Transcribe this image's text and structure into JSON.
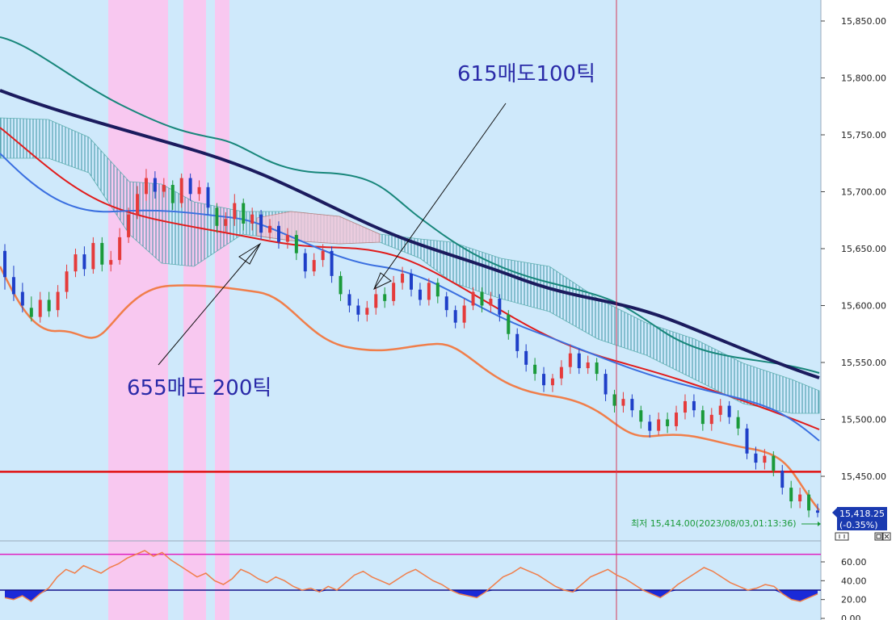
{
  "colors": {
    "plot_bg": "#cfe9fb",
    "highlight": "#f8c8f0",
    "axis_bg": "#ffffff",
    "up": "#e53b3b",
    "down": "#1f3fc8",
    "green_candle": "#1a9a3a",
    "ma_navy": "#1b1b5e",
    "ma_teal": "#17867a",
    "ma_red": "#e11b1b",
    "ma_blue": "#3a6fe0",
    "ma_orange": "#f07e4a",
    "level_line": "#e01010",
    "cursor_line": "#d43a5a",
    "osc_line": "#f07e4a",
    "osc_fill": "#1a2ad8",
    "osc_upper": "#e020c0",
    "osc_lower": "#10108a",
    "annotation": "#2a2aa8",
    "price_tag": "#1a3ab0"
  },
  "annotations": {
    "sell_615": "615매도100틱",
    "sell_655": "655매도 200틱"
  },
  "low_marker": "최저 15,414.00(2023/08/03,01:13:36)",
  "current_price": {
    "value": "15,418.25",
    "change": "(-0.35%)"
  },
  "panel_icons": [
    "collapse-icon",
    "close-icon"
  ],
  "chart_data": {
    "type": "candlestick",
    "y_ticks": [
      "15,850.00",
      "15,800.00",
      "15,750.00",
      "15,700.00",
      "15,650.00",
      "15,600.00",
      "15,550.00",
      "15,500.00",
      "15,450.00"
    ],
    "ylim": [
      15415,
      15865
    ],
    "horizontal_level": 15454,
    "candles": [
      [
        15648,
        15625,
        15654,
        15614,
        "down"
      ],
      [
        15625,
        15610,
        15635,
        15604,
        "down"
      ],
      [
        15612,
        15600,
        15620,
        15594,
        "down"
      ],
      [
        15598,
        15590,
        15608,
        15586,
        "green"
      ],
      [
        15590,
        15605,
        15612,
        15585,
        "up"
      ],
      [
        15605,
        15595,
        15612,
        15590,
        "green"
      ],
      [
        15596,
        15612,
        15618,
        15590,
        "up"
      ],
      [
        15612,
        15630,
        15636,
        15606,
        "up"
      ],
      [
        15630,
        15645,
        15650,
        15625,
        "up"
      ],
      [
        15645,
        15632,
        15652,
        15626,
        "down"
      ],
      [
        15632,
        15655,
        15660,
        15628,
        "up"
      ],
      [
        15655,
        15636,
        15660,
        15630,
        "green"
      ],
      [
        15636,
        15640,
        15648,
        15630,
        "up"
      ],
      [
        15640,
        15660,
        15668,
        15636,
        "up"
      ],
      [
        15660,
        15680,
        15686,
        15655,
        "up"
      ],
      [
        15680,
        15698,
        15705,
        15676,
        "up"
      ],
      [
        15698,
        15712,
        15720,
        15692,
        "up"
      ],
      [
        15712,
        15700,
        15718,
        15694,
        "down"
      ],
      [
        15700,
        15706,
        15712,
        15695,
        "up"
      ],
      [
        15706,
        15690,
        15710,
        15684,
        "green"
      ],
      [
        15690,
        15712,
        15716,
        15686,
        "up"
      ],
      [
        15712,
        15698,
        15716,
        15692,
        "down"
      ],
      [
        15698,
        15704,
        15710,
        15692,
        "up"
      ],
      [
        15704,
        15686,
        15708,
        15680,
        "down"
      ],
      [
        15686,
        15670,
        15690,
        15664,
        "green"
      ],
      [
        15670,
        15676,
        15682,
        15664,
        "up"
      ],
      [
        15676,
        15690,
        15698,
        15670,
        "up"
      ],
      [
        15690,
        15672,
        15694,
        15666,
        "green"
      ],
      [
        15672,
        15680,
        15686,
        15666,
        "up"
      ],
      [
        15680,
        15664,
        15684,
        15658,
        "down"
      ],
      [
        15664,
        15670,
        15676,
        15658,
        "up"
      ],
      [
        15670,
        15656,
        15674,
        15650,
        "down"
      ],
      [
        15656,
        15662,
        15668,
        15650,
        "up"
      ],
      [
        15662,
        15646,
        15666,
        15640,
        "green"
      ],
      [
        15646,
        15630,
        15650,
        15624,
        "down"
      ],
      [
        15630,
        15640,
        15646,
        15626,
        "up"
      ],
      [
        15640,
        15648,
        15654,
        15634,
        "up"
      ],
      [
        15648,
        15626,
        15652,
        15620,
        "down"
      ],
      [
        15626,
        15610,
        15630,
        15604,
        "green"
      ],
      [
        15610,
        15600,
        15614,
        15594,
        "down"
      ],
      [
        15600,
        15592,
        15606,
        15586,
        "down"
      ],
      [
        15592,
        15598,
        15604,
        15586,
        "up"
      ],
      [
        15598,
        15610,
        15616,
        15592,
        "up"
      ],
      [
        15610,
        15604,
        15616,
        15598,
        "green"
      ],
      [
        15604,
        15620,
        15626,
        15600,
        "up"
      ],
      [
        15620,
        15628,
        15634,
        15614,
        "up"
      ],
      [
        15628,
        15614,
        15632,
        15608,
        "down"
      ],
      [
        15614,
        15605,
        15620,
        15600,
        "down"
      ],
      [
        15605,
        15620,
        15624,
        15600,
        "up"
      ],
      [
        15620,
        15608,
        15624,
        15602,
        "green"
      ],
      [
        15608,
        15596,
        15612,
        15590,
        "down"
      ],
      [
        15596,
        15585,
        15600,
        15580,
        "down"
      ],
      [
        15585,
        15600,
        15606,
        15580,
        "up"
      ],
      [
        15600,
        15612,
        15616,
        15596,
        "up"
      ],
      [
        15612,
        15600,
        15616,
        15594,
        "green"
      ],
      [
        15600,
        15606,
        15612,
        15594,
        "up"
      ],
      [
        15606,
        15592,
        15610,
        15586,
        "down"
      ],
      [
        15592,
        15575,
        15596,
        15570,
        "green"
      ],
      [
        15575,
        15560,
        15580,
        15554,
        "down"
      ],
      [
        15560,
        15548,
        15566,
        15542,
        "down"
      ],
      [
        15548,
        15540,
        15554,
        15534,
        "green"
      ],
      [
        15540,
        15530,
        15546,
        15524,
        "down"
      ],
      [
        15530,
        15536,
        15540,
        15524,
        "up"
      ],
      [
        15536,
        15546,
        15552,
        15530,
        "up"
      ],
      [
        15546,
        15558,
        15566,
        15540,
        "up"
      ],
      [
        15558,
        15545,
        15562,
        15540,
        "down"
      ],
      [
        15545,
        15550,
        15556,
        15540,
        "up"
      ],
      [
        15550,
        15540,
        15554,
        15534,
        "green"
      ],
      [
        15540,
        15522,
        15544,
        15516,
        "down"
      ],
      [
        15522,
        15512,
        15526,
        15506,
        "green"
      ],
      [
        15512,
        15518,
        15524,
        15506,
        "up"
      ],
      [
        15518,
        15508,
        15522,
        15502,
        "down"
      ],
      [
        15508,
        15498,
        15512,
        15492,
        "green"
      ],
      [
        15498,
        15490,
        15504,
        15484,
        "down"
      ],
      [
        15490,
        15500,
        15506,
        15486,
        "up"
      ],
      [
        15500,
        15494,
        15506,
        15488,
        "green"
      ],
      [
        15494,
        15506,
        15512,
        15490,
        "up"
      ],
      [
        15506,
        15516,
        15522,
        15500,
        "up"
      ],
      [
        15516,
        15508,
        15522,
        15502,
        "down"
      ],
      [
        15508,
        15496,
        15512,
        15490,
        "green"
      ],
      [
        15496,
        15504,
        15510,
        15490,
        "up"
      ],
      [
        15504,
        15512,
        15518,
        15498,
        "up"
      ],
      [
        15512,
        15502,
        15516,
        15496,
        "down"
      ],
      [
        15502,
        15492,
        15508,
        15486,
        "green"
      ],
      [
        15492,
        15470,
        15496,
        15465,
        "down"
      ],
      [
        15470,
        15462,
        15476,
        15456,
        "down"
      ],
      [
        15462,
        15468,
        15474,
        15456,
        "up"
      ],
      [
        15468,
        15455,
        15472,
        15450,
        "green"
      ],
      [
        15455,
        15440,
        15460,
        15434,
        "down"
      ],
      [
        15440,
        15428,
        15446,
        15422,
        "green"
      ],
      [
        15428,
        15434,
        15440,
        15422,
        "up"
      ],
      [
        15434,
        15420,
        15438,
        15414,
        "green"
      ],
      [
        15420,
        15418,
        15426,
        15414,
        "down"
      ]
    ],
    "oscillator": {
      "y_ticks": [
        "60.00",
        "40.00",
        "20.00",
        "0.00"
      ],
      "ylim": [
        0,
        80
      ],
      "upper_level": 68,
      "lower_level": 30,
      "values": [
        22,
        20,
        24,
        18,
        26,
        32,
        44,
        52,
        48,
        56,
        52,
        48,
        54,
        58,
        64,
        68,
        72,
        66,
        70,
        62,
        56,
        50,
        44,
        48,
        40,
        36,
        42,
        52,
        48,
        42,
        38,
        44,
        40,
        34,
        30,
        32,
        28,
        34,
        30,
        38,
        46,
        50,
        44,
        40,
        36,
        42,
        48,
        52,
        46,
        40,
        36,
        30,
        26,
        24,
        22,
        28,
        36,
        44,
        48,
        54,
        50,
        46,
        40,
        34,
        30,
        28,
        36,
        44,
        48,
        52,
        46,
        42,
        36,
        30,
        26,
        22,
        28,
        36,
        42,
        48,
        54,
        50,
        44,
        38,
        34,
        30,
        32,
        36,
        34,
        26,
        20,
        18,
        22,
        26
      ]
    }
  }
}
